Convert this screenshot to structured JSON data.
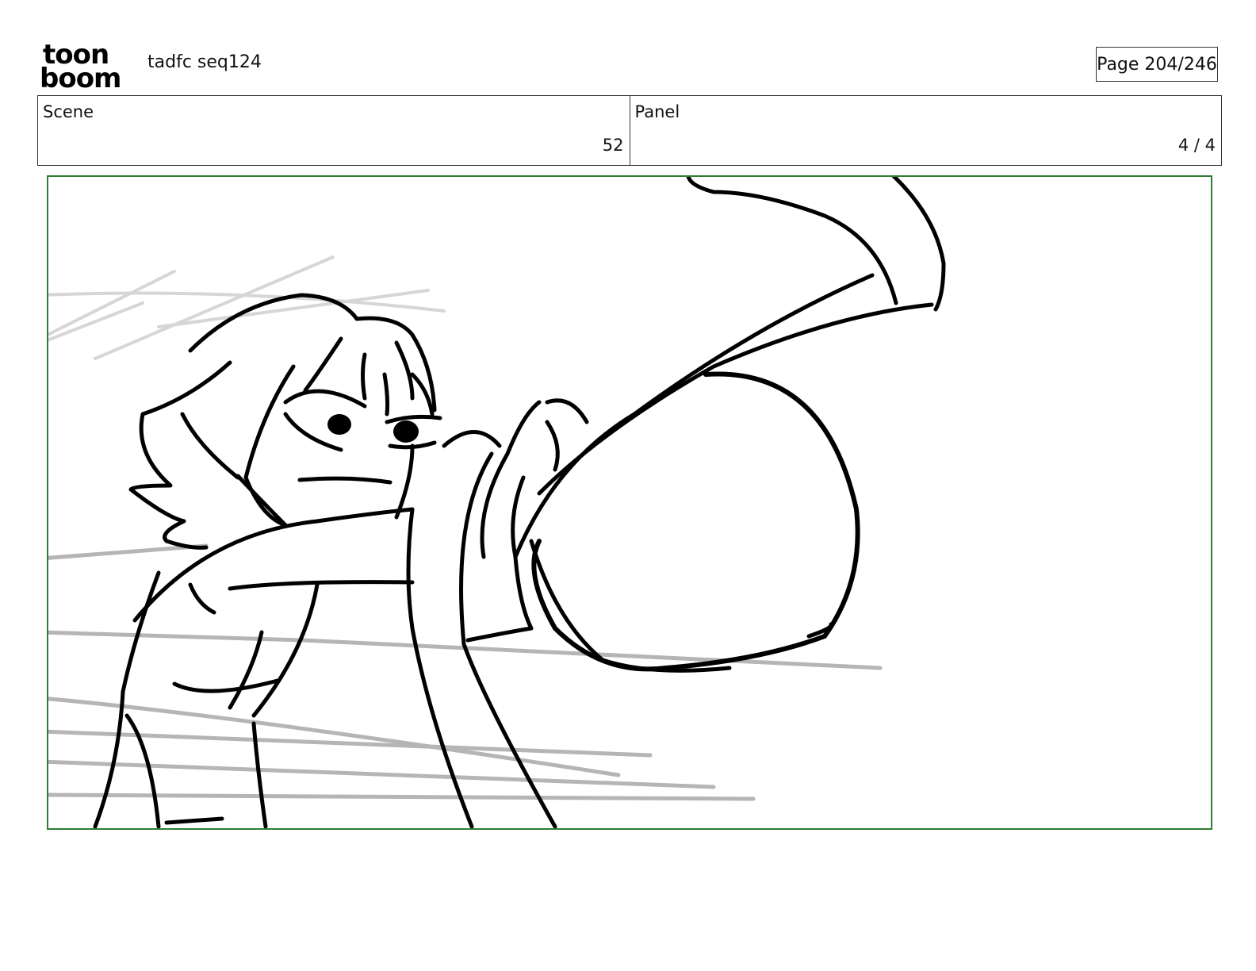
{
  "header": {
    "logo_line1": "toon",
    "logo_line2": "boom",
    "project_title": "tadfc seq124",
    "page_label": "Page 204/246"
  },
  "info": {
    "scene_label": "Scene",
    "scene_value": "52",
    "panel_label": "Panel",
    "panel_value": "4 / 4"
  },
  "panel": {
    "frame_color": "#2e7d32",
    "content": "storyboard-sketch"
  }
}
